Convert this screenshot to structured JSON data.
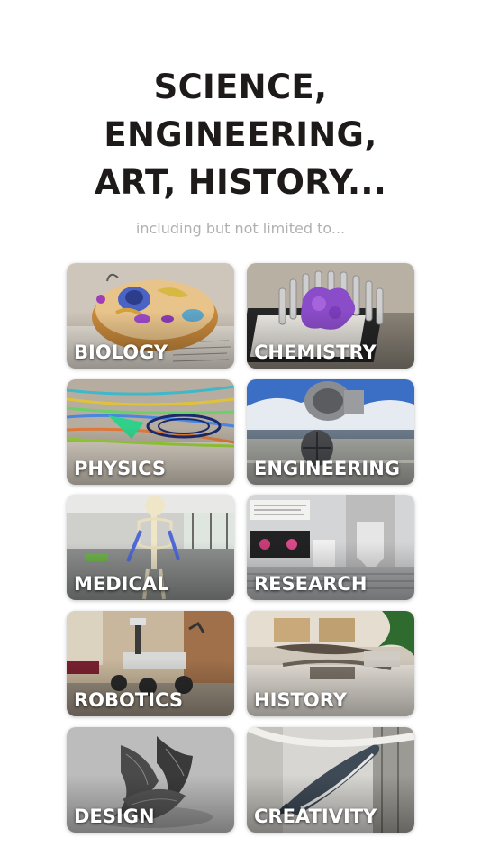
{
  "headline": {
    "line1": "SCIENCE,",
    "line2": "ENGINEERING,",
    "line3": "ART, HISTORY..."
  },
  "subtitle": "including but not limited to...",
  "categories": [
    {
      "label": "BIOLOGY"
    },
    {
      "label": "CHEMISTRY"
    },
    {
      "label": "PHYSICS"
    },
    {
      "label": "ENGINEERING"
    },
    {
      "label": "MEDICAL"
    },
    {
      "label": "RESEARCH"
    },
    {
      "label": "ROBOTICS"
    },
    {
      "label": "HISTORY"
    },
    {
      "label": "DESIGN"
    },
    {
      "label": "CREATIVITY"
    }
  ]
}
